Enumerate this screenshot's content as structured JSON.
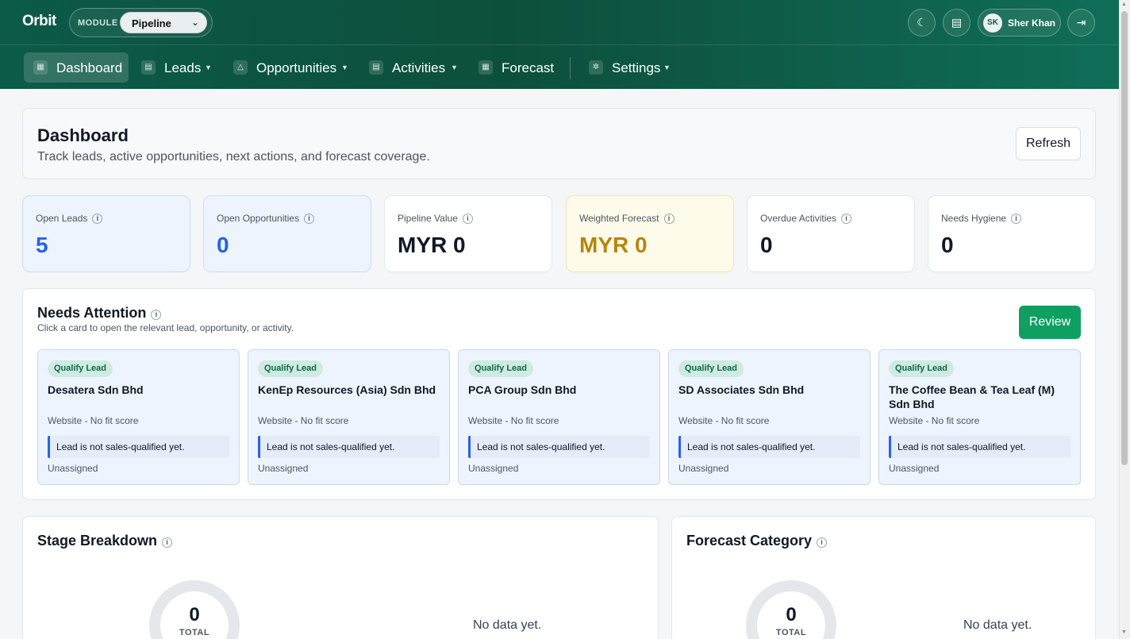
{
  "app": {
    "brand": "Orbit"
  },
  "module": {
    "label": "MODULE",
    "selected": "Pipeline"
  },
  "user": {
    "initials": "SK",
    "name": "Sher Khan"
  },
  "nav": {
    "items": [
      {
        "label": "Dashboard",
        "icon": "dashboard-icon",
        "active": true
      },
      {
        "label": "Leads",
        "icon": "leads-icon",
        "dropdown": true
      },
      {
        "label": "Opportunities",
        "icon": "opportunities-icon",
        "dropdown": true
      },
      {
        "label": "Activities",
        "icon": "activities-icon",
        "dropdown": true
      },
      {
        "label": "Forecast",
        "icon": "forecast-icon"
      },
      {
        "label": "Settings",
        "icon": "settings-icon",
        "dropdown": true
      }
    ]
  },
  "header": {
    "title": "Dashboard",
    "subtitle": "Track leads, active opportunities, next actions, and forecast coverage.",
    "refresh_label": "Refresh"
  },
  "kpis": [
    {
      "label": "Open Leads",
      "value": "5"
    },
    {
      "label": "Open Opportunities",
      "value": "0"
    },
    {
      "label": "Pipeline Value",
      "value": "MYR 0"
    },
    {
      "label": "Weighted Forecast",
      "value": "MYR 0"
    },
    {
      "label": "Overdue Activities",
      "value": "0"
    },
    {
      "label": "Needs Hygiene",
      "value": "0"
    }
  ],
  "attention": {
    "title": "Needs Attention",
    "subtitle": "Click a card to open the relevant lead, opportunity, or activity.",
    "review_label": "Review",
    "cards": [
      {
        "tag": "Qualify Lead",
        "name": "Desatera Sdn Bhd",
        "meta": "Website - No fit score",
        "note": "Lead is not sales-qualified yet.",
        "owner": "Unassigned"
      },
      {
        "tag": "Qualify Lead",
        "name": "KenEp Resources (Asia) Sdn Bhd",
        "meta": "Website - No fit score",
        "note": "Lead is not sales-qualified yet.",
        "owner": "Unassigned"
      },
      {
        "tag": "Qualify Lead",
        "name": "PCA Group Sdn Bhd",
        "meta": "Website - No fit score",
        "note": "Lead is not sales-qualified yet.",
        "owner": "Unassigned"
      },
      {
        "tag": "Qualify Lead",
        "name": "SD Associates Sdn Bhd",
        "meta": "Website - No fit score",
        "note": "Lead is not sales-qualified yet.",
        "owner": "Unassigned"
      },
      {
        "tag": "Qualify Lead",
        "name": "The Coffee Bean & Tea Leaf (M) Sdn Bhd",
        "meta": "Website - No fit score",
        "note": "Lead is not sales-qualified yet.",
        "owner": "Unassigned"
      }
    ]
  },
  "stage_breakdown": {
    "title": "Stage Breakdown",
    "total": "0",
    "total_label": "TOTAL",
    "empty": "No data yet."
  },
  "forecast_category": {
    "title": "Forecast Category",
    "total": "0",
    "total_label": "TOTAL",
    "empty": "No data yet."
  },
  "colors": {
    "topbar": "#0c5a48",
    "accent_green": "#0f9f63",
    "kpi_blue": "#2563eb",
    "kpi_gold": "#b8860b"
  }
}
